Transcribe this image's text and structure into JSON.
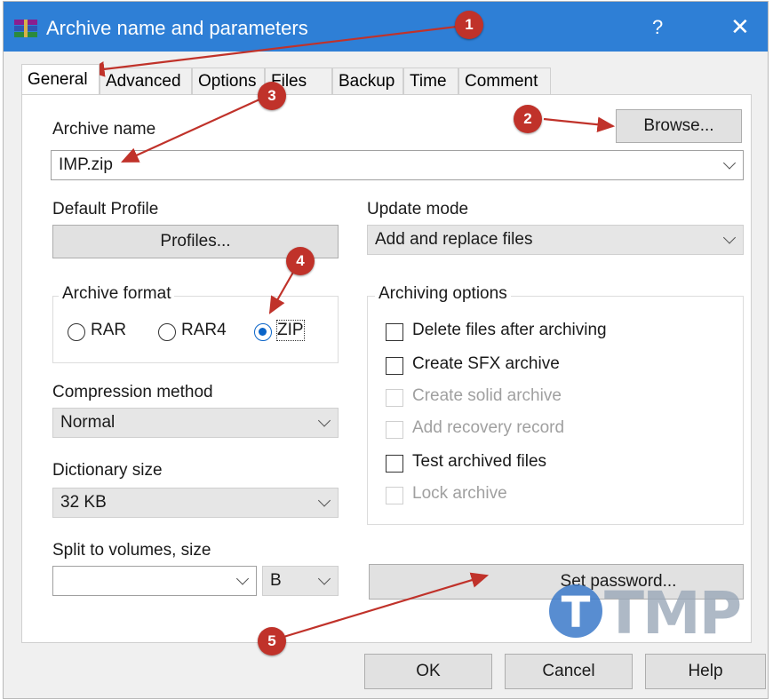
{
  "window": {
    "title": "Archive name and parameters",
    "help_glyph": "?",
    "close_glyph": "✕"
  },
  "tabs": [
    {
      "label": "General",
      "active": true
    },
    {
      "label": "Advanced"
    },
    {
      "label": "Options"
    },
    {
      "label": "Files"
    },
    {
      "label": "Backup"
    },
    {
      "label": "Time"
    },
    {
      "label": "Comment"
    }
  ],
  "archive_name": {
    "label": "Archive name",
    "value": "IMP.zip",
    "browse_label": "Browse..."
  },
  "default_profile": {
    "label": "Default Profile",
    "profiles_button": "Profiles..."
  },
  "update_mode": {
    "label": "Update mode",
    "value": "Add and replace files"
  },
  "archive_format": {
    "label": "Archive format",
    "options": [
      {
        "label": "RAR",
        "selected": false
      },
      {
        "label": "RAR4",
        "selected": false
      },
      {
        "label": "ZIP",
        "selected": true
      }
    ]
  },
  "compression_method": {
    "label": "Compression method",
    "value": "Normal"
  },
  "dictionary_size": {
    "label": "Dictionary size",
    "value": "32 KB"
  },
  "split_volumes": {
    "label": "Split to volumes, size",
    "value": "",
    "unit": "B"
  },
  "archiving_options": {
    "label": "Archiving options",
    "items": [
      {
        "label": "Delete files after archiving",
        "checked": false,
        "enabled": true
      },
      {
        "label": "Create SFX archive",
        "checked": false,
        "enabled": true
      },
      {
        "label": "Create solid archive",
        "checked": false,
        "enabled": false
      },
      {
        "label": "Add recovery record",
        "checked": false,
        "enabled": false
      },
      {
        "label": "Test archived files",
        "checked": false,
        "enabled": true
      },
      {
        "label": "Lock archive",
        "checked": false,
        "enabled": false
      }
    ]
  },
  "set_password_label": "Set password...",
  "footer": {
    "ok": "OK",
    "cancel": "Cancel",
    "help": "Help"
  },
  "annotations": {
    "markers": [
      "1",
      "2",
      "3",
      "4",
      "5"
    ],
    "color": "#c0322a"
  },
  "watermark": {
    "logo_letter": "T",
    "text": "TMP"
  }
}
